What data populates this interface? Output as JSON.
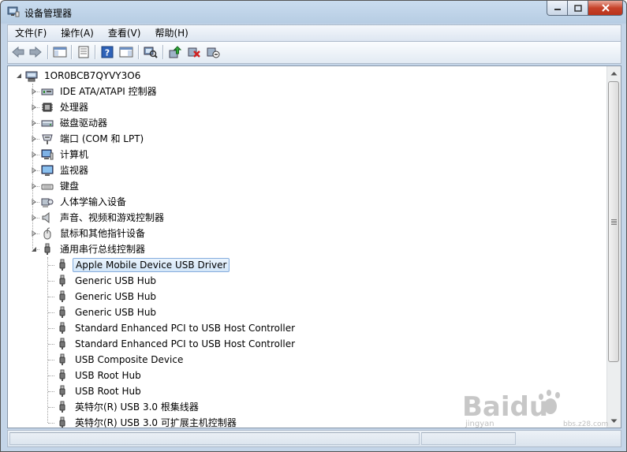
{
  "window": {
    "title": "设备管理器",
    "icon": "device-manager-icon"
  },
  "menu": [
    {
      "label": "文件(F)"
    },
    {
      "label": "操作(A)"
    },
    {
      "label": "查看(V)"
    },
    {
      "label": "帮助(H)"
    }
  ],
  "toolbar": {
    "buttons": [
      "back-arrow-icon",
      "forward-arrow-icon",
      "show-hide-console-tree-icon",
      "properties-icon",
      "help-icon",
      "show-action-pane-icon",
      "scan-hardware-changes-icon",
      "update-driver-icon",
      "uninstall-icon",
      "disable-device-icon"
    ]
  },
  "tree": {
    "root": "1OR0BCB7QYVY3O6",
    "categories": [
      {
        "label": "IDE ATA/ATAPI 控制器",
        "icon": "ide-controller-icon"
      },
      {
        "label": "处理器",
        "icon": "processor-icon"
      },
      {
        "label": "磁盘驱动器",
        "icon": "disk-drive-icon"
      },
      {
        "label": "端口 (COM 和 LPT)",
        "icon": "port-icon"
      },
      {
        "label": "计算机",
        "icon": "computer-icon"
      },
      {
        "label": "监视器",
        "icon": "monitor-icon"
      },
      {
        "label": "键盘",
        "icon": "keyboard-icon"
      },
      {
        "label": "人体学输入设备",
        "icon": "hid-icon"
      },
      {
        "label": "声音、视频和游戏控制器",
        "icon": "speaker-icon"
      },
      {
        "label": "鼠标和其他指针设备",
        "icon": "mouse-icon"
      },
      {
        "label": "通用串行总线控制器",
        "icon": "usb-icon"
      }
    ],
    "usb_children": [
      {
        "label": "Apple Mobile Device USB Driver",
        "selected": true
      },
      {
        "label": "Generic USB Hub"
      },
      {
        "label": "Generic USB Hub"
      },
      {
        "label": "Generic USB Hub"
      },
      {
        "label": "Standard Enhanced PCI to USB Host Controller"
      },
      {
        "label": "Standard Enhanced PCI to USB Host Controller"
      },
      {
        "label": "USB Composite Device"
      },
      {
        "label": "USB Root Hub"
      },
      {
        "label": "USB Root Hub"
      },
      {
        "label": "英特尔(R) USB 3.0 根集线器"
      },
      {
        "label": "英特尔(R) USB 3.0 可扩展主机控制器"
      }
    ]
  },
  "watermark": {
    "brand": "Baidu",
    "subtitle": "jingyan",
    "site": "bbs.z28.com"
  },
  "colors": {
    "selection_border": "#84acdd",
    "close_red": "#c7432a",
    "frame_blue": "#b7cde3"
  }
}
